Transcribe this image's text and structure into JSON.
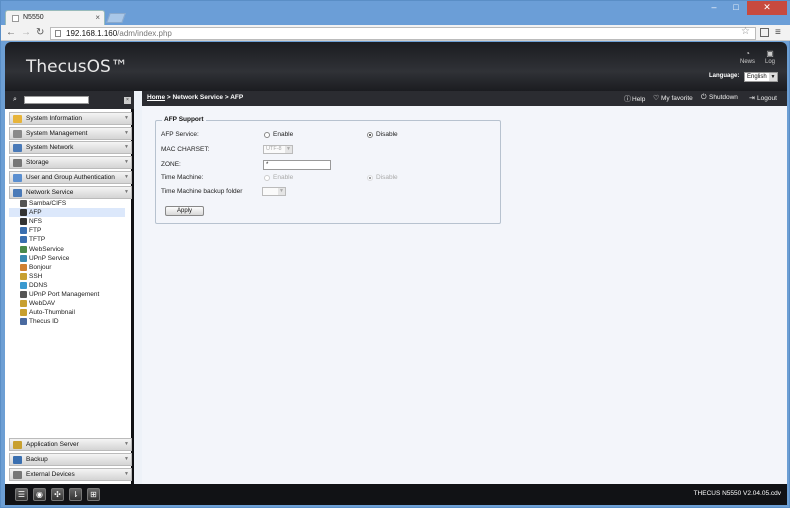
{
  "browser": {
    "tab_title": "N5550",
    "tab_close": "×",
    "url_host": "192.168.1.160",
    "url_path": "/adm/index.php",
    "window_buttons": {
      "minimize": "–",
      "maximize": "□",
      "close": "✕"
    }
  },
  "header": {
    "logo": "ThecusOS™",
    "news_label": "News",
    "log_label": "Log",
    "language_label": "Language:",
    "language_value": "English"
  },
  "sidebar": {
    "categories_top": [
      {
        "label": "System Information",
        "icon": "info-icon",
        "color": "#e7b43a"
      },
      {
        "label": "System Management",
        "icon": "tools-icon",
        "color": "#8a8a8a"
      },
      {
        "label": "System Network",
        "icon": "network-icon",
        "color": "#4a7ab8"
      },
      {
        "label": "Storage",
        "icon": "storage-icon",
        "color": "#777777"
      },
      {
        "label": "User and Group Authentication",
        "icon": "users-icon",
        "color": "#5b8fd0"
      },
      {
        "label": "Network Service",
        "icon": "network-service-icon",
        "color": "#4a7ab8"
      }
    ],
    "network_service_items": [
      {
        "label": "Samba/CIFS",
        "icon": "samba-icon",
        "color": "#555555"
      },
      {
        "label": "AFP",
        "icon": "afp-icon",
        "color": "#333333"
      },
      {
        "label": "NFS",
        "icon": "nfs-icon",
        "color": "#333333"
      },
      {
        "label": "FTP",
        "icon": "ftp-icon",
        "color": "#3a6fb0"
      },
      {
        "label": "TFTP",
        "icon": "tftp-icon",
        "color": "#3a6fb0"
      },
      {
        "label": "WebService",
        "icon": "webservice-icon",
        "color": "#4a8a4a"
      },
      {
        "label": "UPnP Service",
        "icon": "upnp-icon",
        "color": "#3a8ab0"
      },
      {
        "label": "Bonjour",
        "icon": "bonjour-icon",
        "color": "#d08030"
      },
      {
        "label": "SSH",
        "icon": "ssh-icon",
        "color": "#c8a030"
      },
      {
        "label": "DDNS",
        "icon": "ddns-icon",
        "color": "#3a9ad0"
      },
      {
        "label": "UPnP Port Management",
        "icon": "upnp-port-icon",
        "color": "#555555"
      },
      {
        "label": "WebDAV",
        "icon": "webdav-icon",
        "color": "#c8a030"
      },
      {
        "label": "Auto-Thumbnail",
        "icon": "thumbnail-icon",
        "color": "#c8a030"
      },
      {
        "label": "Thecus ID",
        "icon": "thecus-id-icon",
        "color": "#4a6aa0"
      }
    ],
    "categories_bottom": [
      {
        "label": "Application Server",
        "icon": "app-server-icon",
        "color": "#c8a030"
      },
      {
        "label": "Backup",
        "icon": "backup-icon",
        "color": "#3a6fb0"
      },
      {
        "label": "External Devices",
        "icon": "external-devices-icon",
        "color": "#777777"
      }
    ]
  },
  "topbar": {
    "breadcrumb_home": "Home",
    "breadcrumb_rest": " > Network Service > AFP",
    "help": "Help",
    "favorite": "My favorite",
    "shutdown": "Shutdown",
    "logout": "Logout"
  },
  "afp_form": {
    "legend": "AFP Support",
    "service_label": "AFP Service:",
    "enable_label": "Enable",
    "disable_label": "Disable",
    "service_selected": "Disable",
    "charset_label": "MAC CHARSET:",
    "charset_value": "UTF-8",
    "zone_label": "ZONE:",
    "zone_value": "*",
    "time_machine_label": "Time Machine:",
    "tm_enable_label": "Enable",
    "tm_disable_label": "Disable",
    "tm_folder_label": "Time Machine backup folder",
    "tm_folder_value": "",
    "apply_label": "Apply"
  },
  "footer": {
    "version": "THECUS N5550 V2.04.05.cdv"
  }
}
